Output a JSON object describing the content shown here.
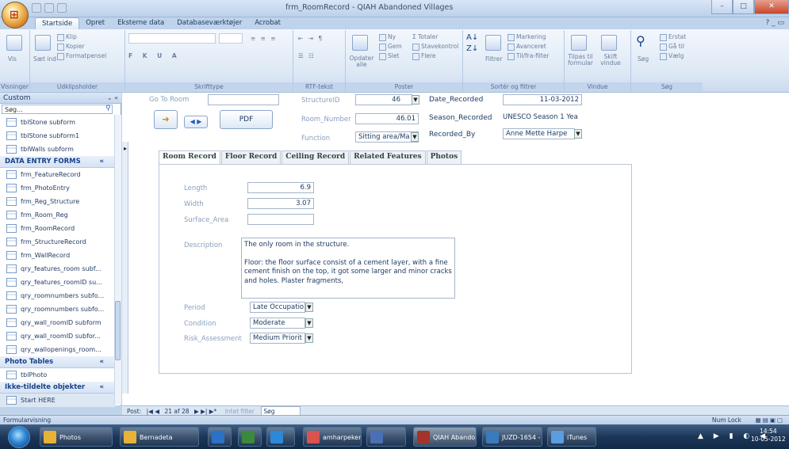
{
  "window": {
    "title": "frm_RoomRecord - QIAH Abandoned Villages",
    "minimize": "–",
    "maximize": "□",
    "close": "✕"
  },
  "ribbon_tabs": [
    "Startside",
    "Opret",
    "Eksterne data",
    "Databaseværktøjer",
    "Acrobat"
  ],
  "help_icons": "? _ ▭",
  "ribbon": {
    "groups": [
      "Visninger",
      "Udklipsholder",
      "Skrifttype",
      "RTF-tekst",
      "Poster",
      "Sortér og filtrer",
      "Vindue",
      "Søg"
    ],
    "vis": "Vis",
    "udklip": [
      "Klip",
      "Kopier",
      "Formatpensel",
      "Sæt ind"
    ],
    "records": [
      "Ny",
      "Gem",
      "Slet",
      "Totaler",
      "Stavekontrol",
      "Flere",
      "Opdater alle"
    ],
    "sort": [
      "Markering",
      "Avanceret",
      "Til/fra-filter",
      "Filtrer"
    ],
    "window": [
      "Tilpas til formular",
      "Skift vindue"
    ],
    "find": [
      "Søg",
      "Erstat",
      "Gå til",
      "Vælg"
    ]
  },
  "nav": {
    "header": "Custom",
    "search_placeholder": "Søg...",
    "header_icons": "⌄ «",
    "top_items": [
      "tblStone subform",
      "tblStone subform1",
      "tblWalls subform"
    ],
    "sections": [
      {
        "title": "DATA ENTRY FORMS",
        "items": [
          "frm_FeatureRecord",
          "frm_PhotoEntry",
          "frm_Reg_Structure",
          "frm_Room_Reg",
          "frm_RoomRecord",
          "frm_StructureRecord",
          "frm_WallRecord",
          "qry_features_room subf...",
          "qry_features_roomID su...",
          "qry_roomnumbers subfo...",
          "qry_roomnumbers subfo...",
          "qry_wall_roomID subform",
          "qry_wall_roomID subfor...",
          "qry_wallopenings_room..."
        ]
      },
      {
        "title": "Photo Tables",
        "items": [
          "tblPhoto"
        ]
      },
      {
        "title": "Ikke-tildelte objekter",
        "items": [
          "Start HERE"
        ]
      }
    ],
    "section_chevron": "«"
  },
  "form": {
    "goto_label": "Go To Room",
    "goto_value": "",
    "pdf_button": "PDF",
    "structure_label": "StructureID",
    "structure_value": "46",
    "room_label": "Room_Number",
    "room_value": "46.01",
    "function_label": "Function",
    "function_value": "Sitting area/Ma",
    "date_label": "Date_Recorded",
    "date_value": "11-03-2012",
    "season_label": "Season_Recorded",
    "season_value": "UNESCO Season 1 Yea",
    "by_label": "Recorded_By",
    "by_value": "Anne Mette Harpe",
    "tabs": [
      "Room Record",
      "Floor Record",
      "Ceiling Record",
      "Related Features",
      "Photos"
    ],
    "length_label": "Length",
    "length_value": "6.9",
    "width_label": "Width",
    "width_value": "3.07",
    "surface_label": "Surface_Area",
    "surface_value": "",
    "desc_label": "Description",
    "desc_p1": "The only room in the structure.",
    "desc_p2": "Floor: the floor surface consist of a cement layer, with a fine cement finish on the top, it got some larger and minor cracks and holes. Plaster fragments,",
    "period_label": "Period",
    "period_value": "Late Occupatio",
    "condition_label": "Condition",
    "condition_value": "Moderate",
    "risk_label": "Risk_Assessment",
    "risk_value": "Medium Priorit",
    "dropdown_glyph": "▼"
  },
  "record_nav": {
    "label": "Post:",
    "position": "21 af 28",
    "filter": "Intet filter",
    "search": "Søg"
  },
  "status": {
    "left": "Formularvisning",
    "right": "Num Lock"
  },
  "taskbar": {
    "items": [
      {
        "label": "Photos",
        "color": "#e7b238"
      },
      {
        "label": "Bernadeta",
        "color": "#e7b238"
      },
      {
        "label": "",
        "color": "#2a72c7"
      },
      {
        "label": "",
        "color": "#3b8a3b"
      },
      {
        "label": "",
        "color": "#2d88d8"
      },
      {
        "label": "amharpekend ...",
        "color": "#d9534f"
      },
      {
        "label": "",
        "color": "#4a6fb5"
      },
      {
        "label": "QIAH Abando...",
        "color": "#a2342b"
      },
      {
        "label": "JUZD-1654 - ...",
        "color": "#3a7bbd"
      },
      {
        "label": "iTunes",
        "color": "#5a9de0"
      }
    ],
    "time": "14:54",
    "date": "10-05-2012",
    "tray": "▲ ▶ ▮ ◐ ◀"
  }
}
